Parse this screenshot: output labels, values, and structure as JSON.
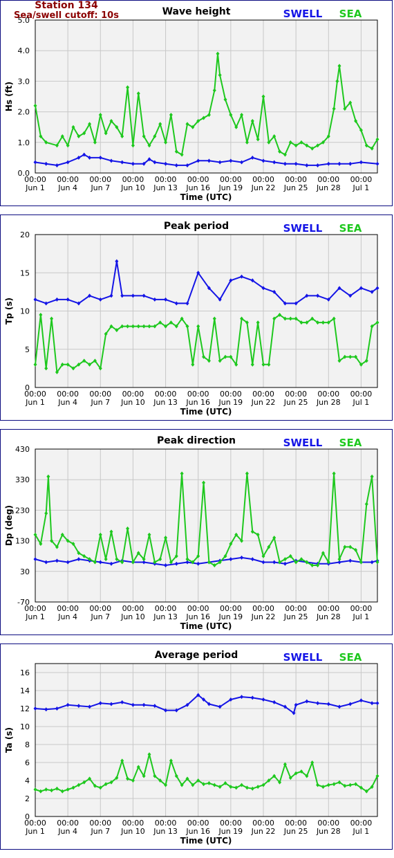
{
  "header": {
    "station": "Station 134",
    "cutoff": "Sea/swell cutoff: 10s"
  },
  "legend": {
    "swell": "SWELL",
    "sea": "SEA"
  },
  "colors": {
    "swell": "#1414e6",
    "sea": "#1ec81e",
    "grid": "#c8c8c8",
    "plot_bg": "#f2f2f2",
    "frame": "#0b0b80",
    "header": "#8b0000"
  },
  "x_axis": {
    "label": "Time (UTC)",
    "range_days": [
      0,
      31.5
    ],
    "ticks": [
      {
        "day": 0,
        "time": "00:00",
        "date": "Jun 1"
      },
      {
        "day": 3,
        "time": "00:00",
        "date": "Jun 4"
      },
      {
        "day": 6,
        "time": "00:00",
        "date": "Jun 7"
      },
      {
        "day": 9,
        "time": "00:00",
        "date": "Jun 10"
      },
      {
        "day": 12,
        "time": "00:00",
        "date": "Jun 13"
      },
      {
        "day": 15,
        "time": "00:00",
        "date": "Jun 16"
      },
      {
        "day": 18,
        "time": "00:00",
        "date": "Jun 19"
      },
      {
        "day": 21,
        "time": "00:00",
        "date": "Jun 22"
      },
      {
        "day": 24,
        "time": "00:00",
        "date": "Jun 25"
      },
      {
        "day": 27,
        "time": "00:00",
        "date": "Jun 28"
      },
      {
        "day": 30,
        "time": "00:00",
        "date": "Jul 1"
      }
    ]
  },
  "chart_data": [
    {
      "type": "line",
      "title": "Wave height",
      "ylabel": "Hs (ft)",
      "ylim": [
        0,
        5
      ],
      "yticks": [
        "0.0",
        "1.0",
        "2.0",
        "3.0",
        "4.0",
        "5.0"
      ],
      "grid": true,
      "legend": "top-right",
      "series": [
        {
          "name": "SWELL",
          "x": [
            0,
            1,
            2,
            3,
            4,
            4.5,
            5,
            6,
            7,
            8,
            9,
            10,
            10.5,
            11,
            12,
            13,
            14,
            15,
            16,
            17,
            18,
            19,
            20,
            21,
            22,
            23,
            24,
            25,
            26,
            27,
            28,
            29,
            30,
            31.5
          ],
          "values": [
            0.35,
            0.3,
            0.25,
            0.35,
            0.5,
            0.6,
            0.5,
            0.5,
            0.4,
            0.35,
            0.3,
            0.3,
            0.45,
            0.35,
            0.3,
            0.25,
            0.25,
            0.4,
            0.4,
            0.35,
            0.4,
            0.35,
            0.5,
            0.4,
            0.35,
            0.3,
            0.3,
            0.25,
            0.25,
            0.3,
            0.3,
            0.3,
            0.35,
            0.3
          ]
        },
        {
          "name": "SEA",
          "x": [
            0,
            0.5,
            1,
            2,
            2.5,
            3,
            3.5,
            4,
            4.5,
            5,
            5.5,
            6,
            6.5,
            7,
            7.5,
            8,
            8.5,
            9,
            9.5,
            10,
            10.5,
            11,
            11.5,
            12,
            12.5,
            13,
            13.5,
            14,
            14.5,
            15,
            15.5,
            16,
            16.5,
            16.8,
            17,
            17.5,
            18,
            18.5,
            19,
            19.5,
            20,
            20.5,
            21,
            21.5,
            22,
            22.5,
            23,
            23.5,
            24,
            24.5,
            25,
            25.5,
            26,
            26.5,
            27,
            27.5,
            27.8,
            28,
            28.5,
            29,
            29.5,
            30,
            30.5,
            31,
            31.5
          ],
          "values": [
            2.2,
            1.2,
            1.0,
            0.9,
            1.2,
            0.9,
            1.5,
            1.2,
            1.3,
            1.6,
            1.0,
            1.9,
            1.3,
            1.7,
            1.5,
            1.2,
            2.8,
            0.9,
            2.6,
            1.2,
            0.9,
            1.2,
            1.6,
            1.0,
            1.9,
            0.7,
            0.6,
            1.6,
            1.5,
            1.7,
            1.8,
            1.9,
            2.7,
            3.9,
            3.2,
            2.4,
            1.9,
            1.5,
            1.9,
            1.0,
            1.7,
            1.1,
            2.5,
            1.0,
            1.2,
            0.7,
            0.6,
            1.0,
            0.9,
            1.0,
            0.9,
            0.8,
            0.9,
            1.0,
            1.2,
            2.1,
            3.0,
            3.5,
            2.1,
            2.3,
            1.7,
            1.4,
            0.9,
            0.8,
            1.1
          ]
        }
      ]
    },
    {
      "type": "line",
      "title": "Peak period",
      "ylabel": "Tp (s)",
      "ylim": [
        0,
        20
      ],
      "yticks": [
        "0",
        "5",
        "10",
        "15",
        "20"
      ],
      "grid": true,
      "legend": "top-right",
      "series": [
        {
          "name": "SWELL",
          "x": [
            0,
            1,
            2,
            3,
            4,
            5,
            6,
            7,
            7.5,
            8,
            9,
            10,
            11,
            12,
            13,
            14,
            15,
            16,
            17,
            18,
            19,
            20,
            21,
            22,
            23,
            24,
            25,
            26,
            27,
            28,
            29,
            30,
            31,
            31.5
          ],
          "values": [
            11.5,
            11,
            11.5,
            11.5,
            11,
            12,
            11.5,
            12,
            16.5,
            12,
            12,
            12,
            11.5,
            11.5,
            11,
            11,
            15,
            13,
            11.5,
            14,
            14.5,
            14,
            13,
            12.5,
            11,
            11,
            12,
            12,
            11.5,
            13,
            12,
            13,
            12.5,
            13
          ]
        },
        {
          "name": "SEA",
          "x": [
            0,
            0.5,
            1,
            1.5,
            2,
            2.5,
            3,
            3.5,
            4,
            4.5,
            5,
            5.5,
            6,
            6.5,
            7,
            7.5,
            8,
            8.5,
            9,
            9.5,
            10,
            10.5,
            11,
            11.5,
            12,
            12.5,
            13,
            13.5,
            14,
            14.5,
            15,
            15.5,
            16,
            16.5,
            17,
            17.5,
            18,
            18.5,
            19,
            19.5,
            20,
            20.5,
            21,
            21.5,
            22,
            22.5,
            23,
            23.5,
            24,
            24.5,
            25,
            25.5,
            26,
            26.5,
            27,
            27.5,
            28,
            28.5,
            29,
            29.5,
            30,
            30.5,
            31,
            31.5
          ],
          "values": [
            3,
            9.5,
            2.5,
            9,
            2,
            3,
            3,
            2.5,
            3,
            3.5,
            3,
            3.5,
            2.5,
            7,
            8,
            7.5,
            8,
            8,
            8,
            8,
            8,
            8,
            8,
            8.5,
            8,
            8.5,
            8,
            9,
            8,
            3,
            8,
            4,
            3.5,
            9,
            3.5,
            4,
            4,
            3,
            9,
            8.5,
            3,
            8.5,
            3,
            3,
            9,
            9.5,
            9,
            9,
            9,
            8.5,
            8.5,
            9,
            8.5,
            8.5,
            8.5,
            9,
            3.5,
            4,
            4,
            4,
            3,
            3.5,
            8,
            8.5
          ]
        }
      ]
    },
    {
      "type": "line",
      "title": "Peak direction",
      "ylabel": "Dp (deg)",
      "ylim": [
        -70,
        430
      ],
      "yticks": [
        "-70",
        "30",
        "130",
        "230",
        "330",
        "430"
      ],
      "grid": true,
      "legend": "top-right",
      "series": [
        {
          "name": "SWELL",
          "x": [
            0,
            1,
            2,
            3,
            4,
            5,
            6,
            7,
            8,
            9,
            10,
            11,
            12,
            13,
            14,
            15,
            16,
            17,
            18,
            19,
            20,
            21,
            22,
            23,
            24,
            25,
            26,
            27,
            28,
            29,
            30,
            31,
            31.5
          ],
          "values": [
            70,
            60,
            65,
            60,
            70,
            65,
            60,
            55,
            65,
            60,
            60,
            55,
            50,
            55,
            60,
            55,
            60,
            65,
            70,
            75,
            70,
            60,
            60,
            55,
            65,
            60,
            55,
            55,
            60,
            65,
            60,
            60,
            65
          ]
        },
        {
          "name": "SEA",
          "x": [
            0,
            0.5,
            1,
            1.2,
            1.5,
            2,
            2.5,
            3,
            3.5,
            4,
            4.5,
            5,
            5.5,
            6,
            6.5,
            7,
            7.5,
            8,
            8.5,
            9,
            9.5,
            10,
            10.5,
            11,
            11.5,
            12,
            12.5,
            13,
            13.5,
            14,
            14.5,
            15,
            15.5,
            16,
            16.5,
            17,
            17.5,
            18,
            18.5,
            19,
            19.5,
            20,
            20.5,
            21,
            21.5,
            22,
            22.5,
            23,
            23.5,
            24,
            24.5,
            25,
            25.5,
            26,
            26.5,
            27,
            27.5,
            28,
            28.5,
            29,
            29.5,
            30,
            30.5,
            31,
            31.5
          ],
          "values": [
            150,
            120,
            220,
            340,
            130,
            110,
            150,
            130,
            120,
            90,
            80,
            70,
            60,
            150,
            70,
            160,
            70,
            60,
            170,
            60,
            90,
            70,
            150,
            60,
            70,
            140,
            60,
            80,
            350,
            70,
            60,
            80,
            320,
            60,
            50,
            60,
            80,
            120,
            150,
            130,
            350,
            160,
            150,
            80,
            110,
            140,
            60,
            70,
            80,
            60,
            70,
            60,
            50,
            50,
            90,
            60,
            350,
            70,
            110,
            110,
            100,
            60,
            250,
            340,
            60
          ]
        }
      ]
    },
    {
      "type": "line",
      "title": "Average period",
      "ylabel": "Ta (s)",
      "ylim": [
        0,
        17
      ],
      "yticks": [
        "0",
        "2",
        "4",
        "6",
        "8",
        "10",
        "12",
        "14",
        "16"
      ],
      "grid": true,
      "legend": "top-right",
      "series": [
        {
          "name": "SWELL",
          "x": [
            0,
            1,
            2,
            3,
            4,
            5,
            6,
            7,
            8,
            9,
            10,
            11,
            12,
            13,
            14,
            15,
            15.5,
            16,
            17,
            18,
            19,
            20,
            21,
            22,
            23,
            23.8,
            24,
            25,
            26,
            27,
            28,
            29,
            30,
            31,
            31.5
          ],
          "values": [
            12,
            11.9,
            12,
            12.4,
            12.3,
            12.2,
            12.6,
            12.5,
            12.7,
            12.4,
            12.4,
            12.3,
            11.8,
            11.8,
            12.4,
            13.5,
            13,
            12.5,
            12.2,
            13,
            13.3,
            13.2,
            13,
            12.7,
            12.2,
            11.5,
            12.4,
            12.8,
            12.6,
            12.5,
            12.2,
            12.5,
            12.9,
            12.6,
            12.6
          ]
        },
        {
          "name": "SEA",
          "x": [
            0,
            0.5,
            1,
            1.5,
            2,
            2.5,
            3,
            3.5,
            4,
            4.5,
            5,
            5.5,
            6,
            6.5,
            7,
            7.5,
            8,
            8.5,
            9,
            9.5,
            10,
            10.5,
            11,
            11.5,
            12,
            12.5,
            13,
            13.5,
            14,
            14.5,
            15,
            15.5,
            16,
            16.5,
            17,
            17.5,
            18,
            18.5,
            19,
            19.5,
            20,
            20.5,
            21,
            21.5,
            22,
            22.5,
            23,
            23.5,
            24,
            24.5,
            25,
            25.5,
            26,
            26.5,
            27,
            27.5,
            28,
            28.5,
            29,
            29.5,
            30,
            30.5,
            31,
            31.5
          ],
          "values": [
            3,
            2.8,
            3,
            2.9,
            3.1,
            2.8,
            3,
            3.2,
            3.5,
            3.8,
            4.2,
            3.4,
            3.2,
            3.6,
            3.8,
            4.3,
            6.2,
            4.2,
            4,
            5.5,
            4.5,
            6.9,
            4.5,
            4,
            3.5,
            6.2,
            4.5,
            3.5,
            4.2,
            3.5,
            4,
            3.6,
            3.7,
            3.5,
            3.3,
            3.7,
            3.3,
            3.2,
            3.5,
            3.2,
            3.1,
            3.3,
            3.5,
            4,
            4.5,
            3.8,
            5.8,
            4.3,
            4.8,
            5,
            4.5,
            6,
            3.5,
            3.3,
            3.5,
            3.6,
            3.8,
            3.4,
            3.5,
            3.6,
            3.2,
            2.8,
            3.3,
            4.5
          ]
        }
      ]
    }
  ]
}
